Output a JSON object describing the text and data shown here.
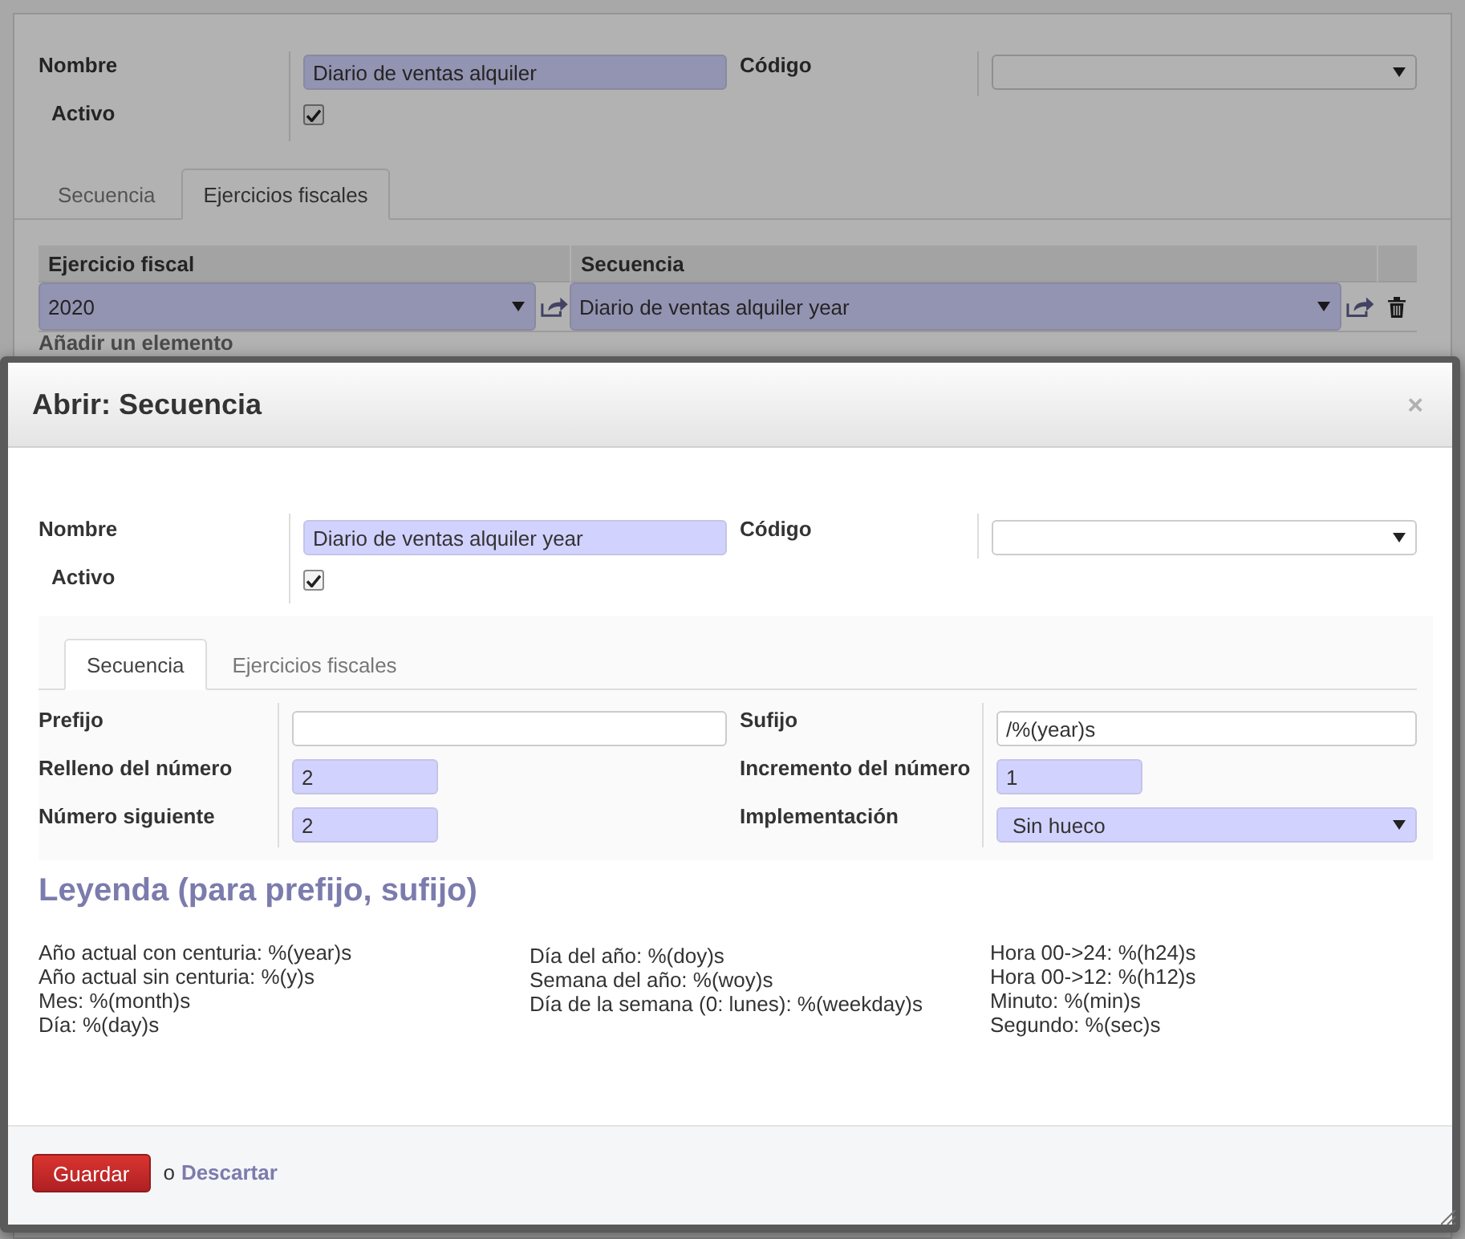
{
  "background_form": {
    "groups": [
      {
        "fields": [
          {
            "kind": "text",
            "label": "Nombre",
            "value": "Diario de ventas alquiler",
            "required": true
          },
          {
            "kind": "checkbox",
            "label": "Activo",
            "checked": true
          }
        ]
      },
      {
        "fields": [
          {
            "kind": "select",
            "label": "Código",
            "required": false
          }
        ]
      }
    ],
    "tabs": [
      {
        "label": "Secuencia",
        "selected": false
      },
      {
        "label": "Ejercicios fiscales",
        "selected": true
      }
    ],
    "table": {
      "columns": [
        "Ejercicio fiscal",
        "Secuencia"
      ],
      "rows": [
        {
          "fiscal_year": "2020",
          "sequence": "Diario de ventas alquiler year"
        }
      ]
    },
    "add_line": "Añadir un elemento"
  },
  "dialog": {
    "title": "Abrir: Secuencia",
    "close": "×",
    "groups": [
      {
        "fields": [
          {
            "kind": "text",
            "label": "Nombre",
            "value": "Diario de ventas alquiler year",
            "required": true
          },
          {
            "kind": "checkbox",
            "label": "Activo",
            "checked": true
          }
        ]
      },
      {
        "fields": [
          {
            "kind": "select",
            "label": "Código",
            "required": false
          }
        ]
      }
    ],
    "tabs": [
      {
        "label": "Secuencia",
        "selected": true
      },
      {
        "label": "Ejercicios fiscales",
        "selected": false
      }
    ],
    "sequence_groups": [
      {
        "fields": [
          {
            "kind": "text",
            "label": "Prefijo",
            "required": false
          },
          {
            "kind": "number",
            "label": "Relleno del número",
            "value": "2",
            "required": true
          },
          {
            "kind": "number",
            "label": "Número siguiente",
            "value": "2",
            "required": true
          }
        ]
      },
      {
        "fields": [
          {
            "kind": "text",
            "label": "Sufijo",
            "value": "/%(year)s",
            "required": false
          },
          {
            "kind": "number",
            "label": "Incremento del número",
            "value": "1",
            "required": true
          },
          {
            "kind": "select",
            "label": "Implementación",
            "value": "Sin hueco",
            "required": true
          }
        ]
      }
    ],
    "legend": {
      "title": "Leyenda (para prefijo, sufijo)",
      "columns": [
        {
          "lines": [
            "Año actual con centuria: %(year)s",
            "Año actual sin centuria: %(y)s",
            "Mes: %(month)s",
            "Día: %(day)s"
          ]
        },
        {
          "lines": [
            "Día del año: %(doy)s",
            "Semana del año: %(woy)s",
            "Día de la semana (0: lunes): %(weekday)s"
          ]
        },
        {
          "lines": [
            "Hora 00->24: %(h24)s",
            "Hora 00->12: %(h12)s",
            "Minuto: %(min)s",
            "Segundo: %(sec)s"
          ]
        }
      ]
    },
    "footer": {
      "save": "Guardar",
      "separator": "o",
      "discard": "Descartar"
    }
  }
}
